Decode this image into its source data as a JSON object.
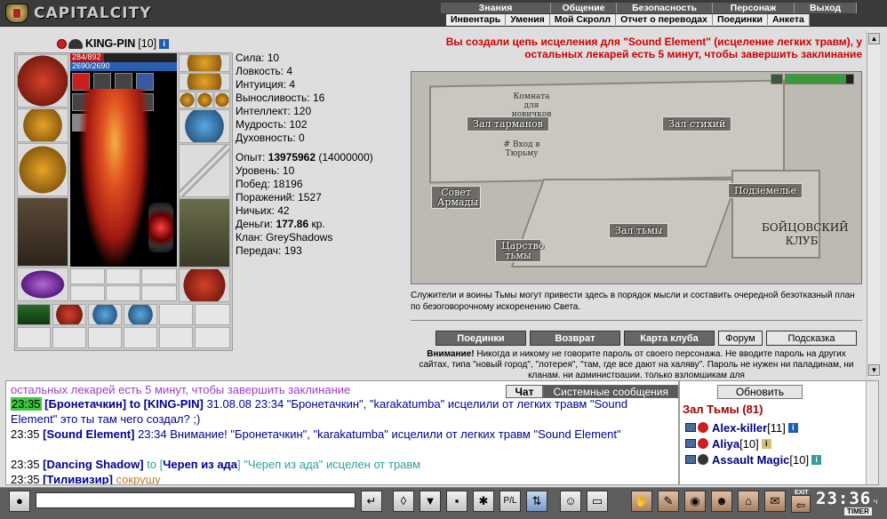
{
  "app": {
    "logo_text": "CAPITALCITY"
  },
  "menu": {
    "row1": [
      "Знания",
      "Общение",
      "Безопасность",
      "Персонаж",
      "Выход"
    ],
    "row2": [
      "Инвентарь",
      "Умения",
      "Мой Скролл",
      "Отчет о переводах",
      "Поединки",
      "Анкета"
    ]
  },
  "character": {
    "name": "KING-PIN",
    "level": "[10]",
    "hp_text": "284/892",
    "hp_fraction": 0.318,
    "mp_text": "2690/2690",
    "mp_fraction": 1.0,
    "stats": [
      "Сила: 10",
      "Ловкость: 4",
      "Интуиция: 4",
      "Выносливость: 16",
      "Интеллект: 120",
      "Мудрость: 102",
      "Духовность: 0"
    ],
    "exp_label": "Опыт:",
    "exp_value": "13975962",
    "exp_next": "(14000000)",
    "level_line": "Уровень: 10",
    "wins_line": "Побед: 18196",
    "losses_line": "Поражений: 1527",
    "draws_line": "Ничьих: 42",
    "money_label": "Деньги:",
    "money_value": "177.86",
    "money_unit": "кр.",
    "clan_line": "Клан: GreyShadows",
    "transfers_line": "Передач: 193"
  },
  "notice": "Вы создали цепь исцеления для \"Sound Element\" (исцеление легких травм), у остальных лекарей есть 5 минут, чтобы завершить заклинание",
  "map": {
    "rooms": {
      "newbie": "Комната для новичков",
      "tarmans": "Зал тарманов",
      "storm": "Зал стихий",
      "prison": "# Вход в Тюрьму",
      "council": "Совет Армады",
      "dungeon": "Подземелье",
      "darkness": "Зал тьмы",
      "kingdom": "Царство тьмы"
    },
    "club_name": "БОЙЦОВСКИЙ КЛУБ",
    "description": "Служители и воины Тьмы могут привести здесь в порядок мысли и составить очередной безотказный план по безоговорочному искоренению Света."
  },
  "map_buttons": [
    "Поединки",
    "Возврат",
    "Карта клуба",
    "Форум",
    "Подсказка"
  ],
  "warning": {
    "bold": "Внимание!",
    "text": " Никогда и никому не говорите пароль от своего персонажа. Не вводите пароль на других сайтах, типа \"новый город\", \"лотерея\", \"там, где все дают на халяву\". Пароль не нужен ни паладинам, ни кланам, ни администрации, только взломщикам для"
  },
  "chat": {
    "tabs": [
      "Чат",
      "Системные сообщения"
    ],
    "lines": [
      {
        "text": "остальных лекарей есть 5 минут, чтобы завершить заклинание"
      },
      {
        "time": "23:35",
        "nick": "[Бронетачкин]",
        "to": "to [KING-PIN]",
        "msg": "31.08.08 23:34 \"Бронетачкин\", \"karakatumba\" исцелили от легких травм \"Sound Element\" это ты там чего создал? ;)"
      },
      {
        "time": "23:35",
        "nick": "[Sound Element]",
        "msg": "23:34 Внимание! \"Бронетачкин\", \"karakatumba\" исцелили от легких травм \"Sound Element\""
      },
      {
        "time": "23:35",
        "nick": "[Dancing Shadow]",
        "to_pre": "to [",
        "to_nick": "Череп из ада",
        "to_post": "]",
        "msg": "\"Череп из ада\" исцелен от травм"
      },
      {
        "time": "23:35",
        "nick": "[Тиливизир]",
        "msg": "сокрушу"
      }
    ]
  },
  "online": {
    "refresh_label": "Обновить",
    "room_title": "Зал Тьмы (81)",
    "users": [
      {
        "nick": "Alex-killer",
        "level": "[11]"
      },
      {
        "nick": "Aliya",
        "level": "[10]"
      },
      {
        "nick": "Assault Magic",
        "level": "[10]"
      }
    ]
  },
  "clock": {
    "time": "23:36",
    "suffix": "ч",
    "timer_label": "TIMER",
    "exit_label": "EXIT"
  },
  "colors": {
    "accent_red": "#d00000",
    "nick_blue": "#000099",
    "time_green": "#3cc93c",
    "room_title": "#9a0000"
  }
}
